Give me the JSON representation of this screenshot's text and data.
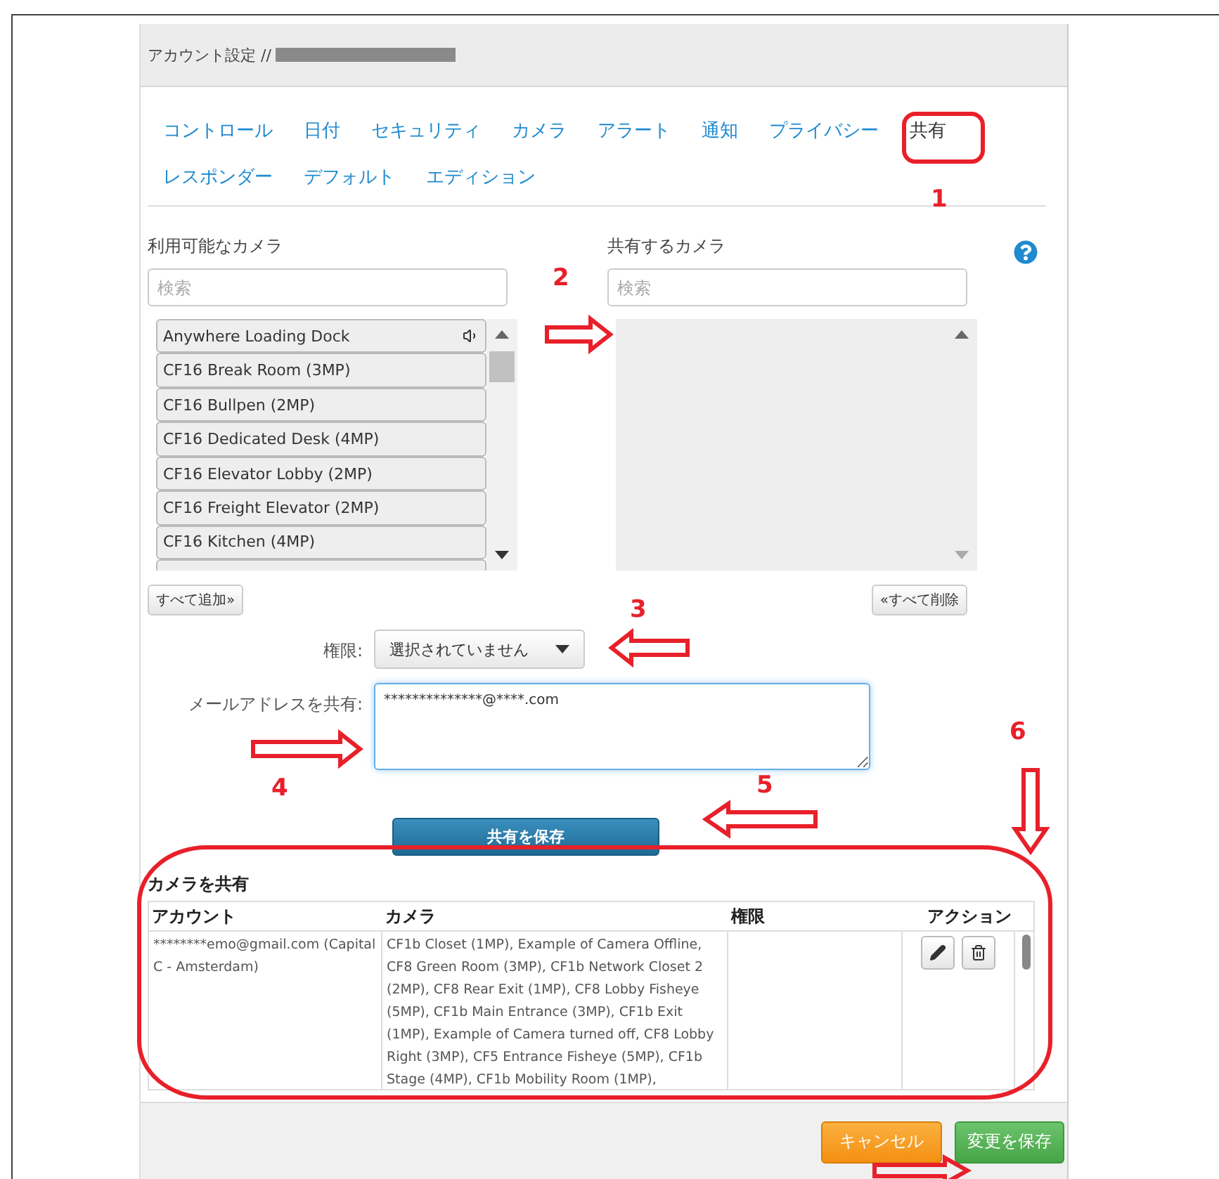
{
  "dialog": {
    "title": "アカウント設定 //"
  },
  "tab_rows": [
    {
      "tabs": [
        {
          "label": "コントロール",
          "selected": false
        },
        {
          "label": "日付",
          "selected": false
        },
        {
          "label": "セキュリティ",
          "selected": false
        },
        {
          "label": "カメラ",
          "selected": false
        },
        {
          "label": "アラート",
          "selected": false
        },
        {
          "label": "通知",
          "selected": false
        },
        {
          "label": "プライバシー",
          "selected": false
        },
        {
          "label": "共有",
          "selected": true
        }
      ]
    },
    {
      "tabs": [
        {
          "label": "レスポンダー",
          "selected": false
        },
        {
          "label": "デフォルト",
          "selected": false
        },
        {
          "label": "エディション",
          "selected": false
        }
      ]
    }
  ],
  "available": {
    "heading": "利用可能なカメラ",
    "search_placeholder": "検索",
    "items": [
      {
        "label": "Anywhere Loading Dock",
        "has_audio": true
      },
      {
        "label": "CF16 Break Room (3MP)",
        "has_audio": false
      },
      {
        "label": "CF16 Bullpen (2MP)",
        "has_audio": false
      },
      {
        "label": "CF16 Dedicated Desk (4MP)",
        "has_audio": false
      },
      {
        "label": "CF16 Elevator Lobby (2MP)",
        "has_audio": false
      },
      {
        "label": "CF16 Freight Elevator (2MP)",
        "has_audio": false
      },
      {
        "label": "CF16 Kitchen (4MP)",
        "has_audio": false
      }
    ],
    "add_all_button": "すべて追加»"
  },
  "shared": {
    "heading": "共有するカメラ",
    "search_placeholder": "検索",
    "remove_all_button": "«すべて削除"
  },
  "permission": {
    "label": "権限:",
    "value": "選択されていません"
  },
  "email": {
    "label": "メールアドレスを共有:",
    "value": "**************@****.com"
  },
  "save_share_button": "共有を保存",
  "shares": {
    "title": "カメラを共有",
    "columns": [
      "アカウント",
      "カメラ",
      "権限",
      "アクション"
    ],
    "rows": [
      {
        "account": "********emo@gmail.com (Capital C - Amsterdam)",
        "cameras": "CF1b Closet (1MP), Example of Camera Offline, CF8 Green Room (3MP), CF1b Network Closet 2 (2MP), CF8 Rear Exit (1MP), CF8 Lobby Fisheye (5MP), CF1b Main Entrance (3MP), CF1b Exit (1MP), Example of Camera turned off, CF8 Lobby Right (3MP), CF5 Entrance Fisheye (5MP), CF1b Stage (4MP), CF1b Mobility Room (1MP),"
      }
    ]
  },
  "footer": {
    "cancel_button": "キャンセル",
    "save_button": "変更を保存"
  },
  "annotations": [
    {
      "label": "1"
    },
    {
      "label": "2"
    },
    {
      "label": "3"
    },
    {
      "label": "4"
    },
    {
      "label": "5"
    },
    {
      "label": "6"
    }
  ]
}
